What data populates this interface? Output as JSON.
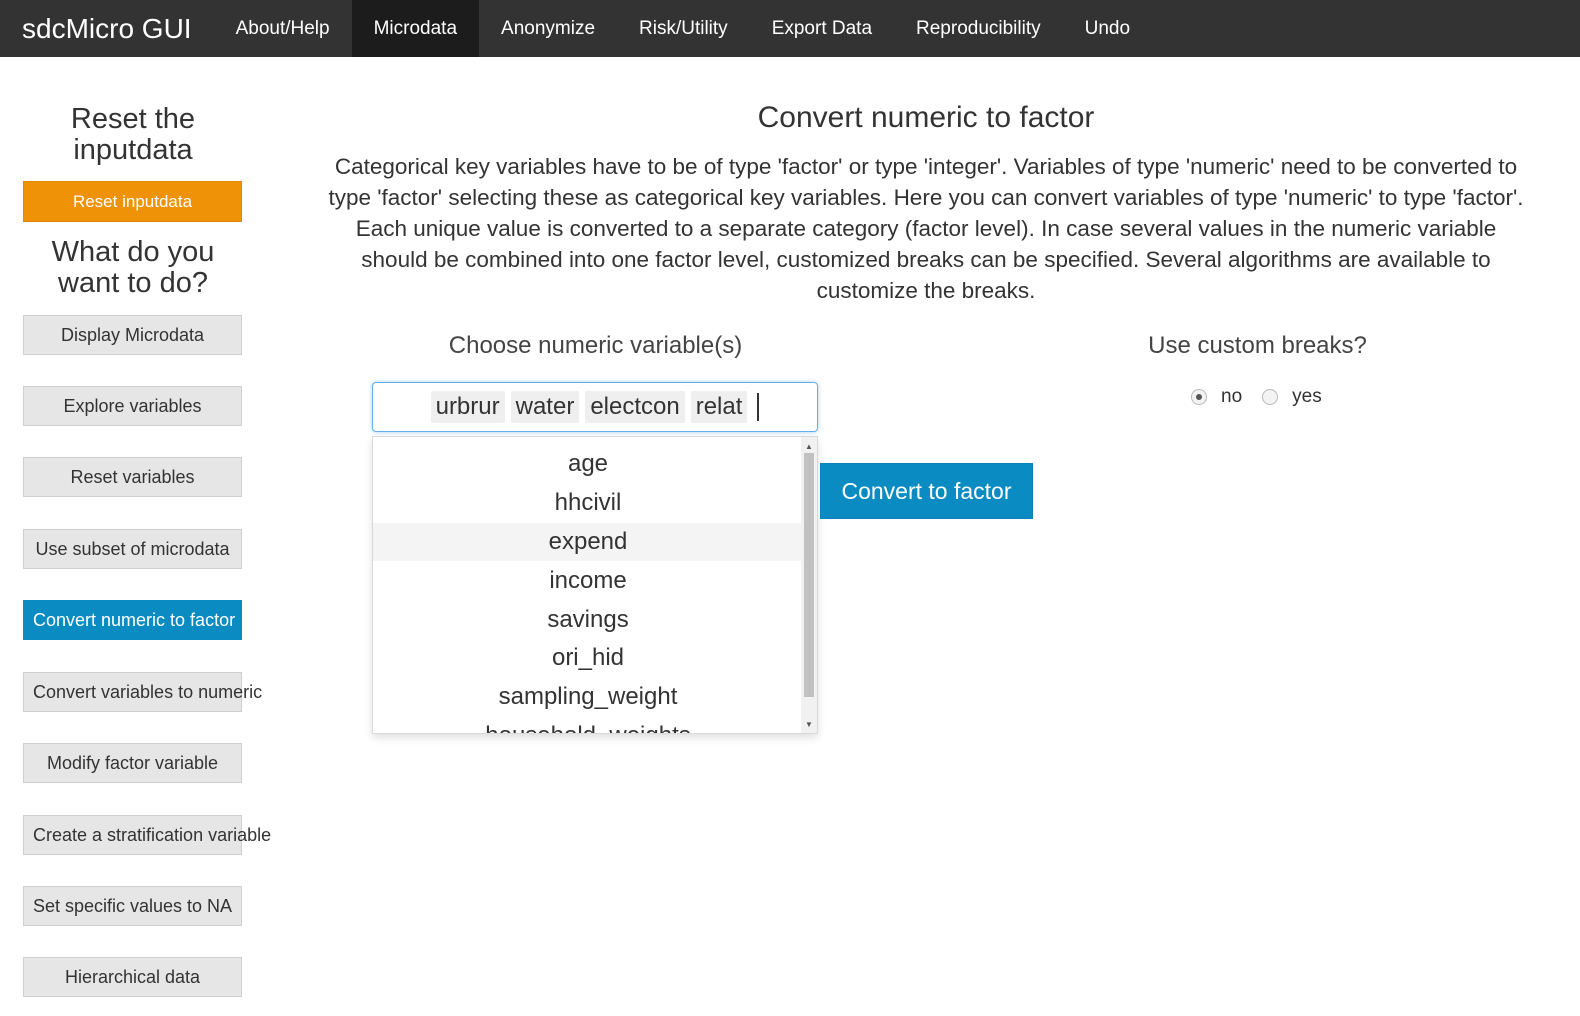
{
  "navbar": {
    "brand": "sdcMicro GUI",
    "items": [
      "About/Help",
      "Microdata",
      "Anonymize",
      "Risk/Utility",
      "Export Data",
      "Reproducibility",
      "Undo"
    ],
    "active": "Microdata"
  },
  "sidebar": {
    "reset_heading": "Reset the inputdata",
    "reset_button": "Reset inputdata",
    "what_heading": "What do you want to do?",
    "buttons": [
      "Display Microdata",
      "Explore variables",
      "Reset variables",
      "Use subset of microdata",
      "Convert numeric to factor",
      "Convert variables to numeric",
      "Modify factor variable",
      "Create a stratification variable",
      "Set specific values to NA",
      "Hierarchical data"
    ],
    "active_button": "Convert numeric to factor",
    "colors": {
      "reset": "#ef9208",
      "active": "#0a8cc3"
    }
  },
  "main": {
    "title": "Convert numeric to factor",
    "description": "Categorical key variables have to be of type 'factor' or type 'integer'. Variables of type 'numeric' need to be converted to type 'factor' selecting these as categorical key variables. Here you can convert variables of type 'numeric' to type 'factor'. Each unique value is converted to a separate category (factor level). In case several values in the numeric variable should be combined into one factor level, customized breaks can be specified. Several algorithms are available to customize the breaks.",
    "choose_label": "Choose numeric variable(s)",
    "selected": [
      "urbrur",
      "water",
      "electcon",
      "relat"
    ],
    "dropdown_options": [
      "age",
      "hhcivil",
      "expend",
      "income",
      "savings",
      "ori_hid",
      "sampling_weight",
      "household_weights"
    ],
    "highlighted_option": "expend",
    "convert_button": "Convert to factor",
    "breaks_label": "Use custom breaks?",
    "radio_options": [
      {
        "label": "no",
        "checked": true
      },
      {
        "label": "yes",
        "checked": false
      }
    ]
  }
}
